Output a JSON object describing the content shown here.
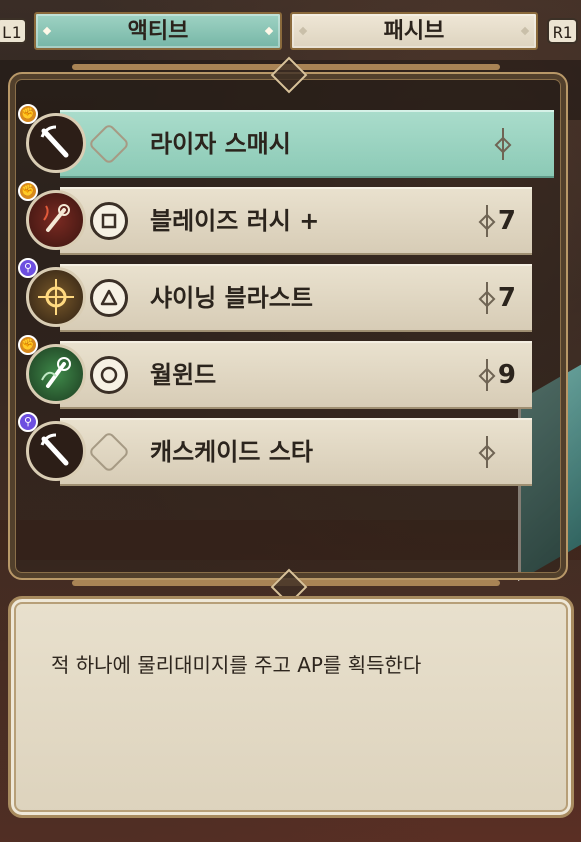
{
  "tabs": {
    "left_hint": "L1",
    "right_hint": "R1",
    "active": "액티브",
    "passive": "패시브"
  },
  "skills": [
    {
      "name": "라이자 스매시",
      "cost": "",
      "type": "physical",
      "button": "",
      "icon": "staff-strike-icon",
      "selected": true
    },
    {
      "name": "블레이즈 러시 +",
      "cost": "7",
      "type": "physical",
      "button": "square",
      "icon": "fire-staff-icon",
      "selected": false
    },
    {
      "name": "샤이닝 블라스트",
      "cost": "7",
      "type": "magic",
      "button": "triangle",
      "icon": "light-burst-icon",
      "selected": false
    },
    {
      "name": "월윈드",
      "cost": "9",
      "type": "physical",
      "button": "circle",
      "icon": "wind-staff-icon",
      "selected": false
    },
    {
      "name": "캐스케이드 스타",
      "cost": "",
      "type": "magic",
      "button": "",
      "icon": "staff-strike-icon",
      "selected": false
    }
  ],
  "description": "적 하나에 물리대미지를 주고 AP를 획득한다",
  "colors": {
    "active_tab": "#8cc8b6",
    "selected_row": "#9cd5c1",
    "physical_badge": "#d7891e",
    "magic_badge": "#6d4fe0"
  }
}
